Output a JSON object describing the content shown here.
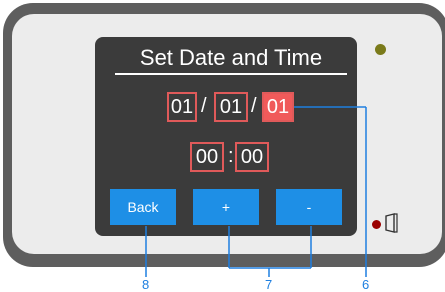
{
  "screen": {
    "title": "Set Date and Time",
    "date": {
      "day": "01",
      "month": "01",
      "year": "01",
      "separator": "/"
    },
    "time": {
      "hour": "00",
      "minute": "00",
      "separator": ":"
    },
    "buttons": {
      "back": "Back",
      "plus": "+",
      "minus": "-"
    }
  },
  "callouts": {
    "back": "8",
    "plus_minus": "7",
    "year": "6"
  },
  "icons": {
    "status_led": "green-led-icon",
    "door_led": "red-led-icon",
    "door": "door-icon"
  },
  "colors": {
    "accent_button": "#1e8fe6",
    "field_border": "#e05a5a",
    "selected_field": "#f05a5a",
    "callout": "#1e7fe0"
  }
}
